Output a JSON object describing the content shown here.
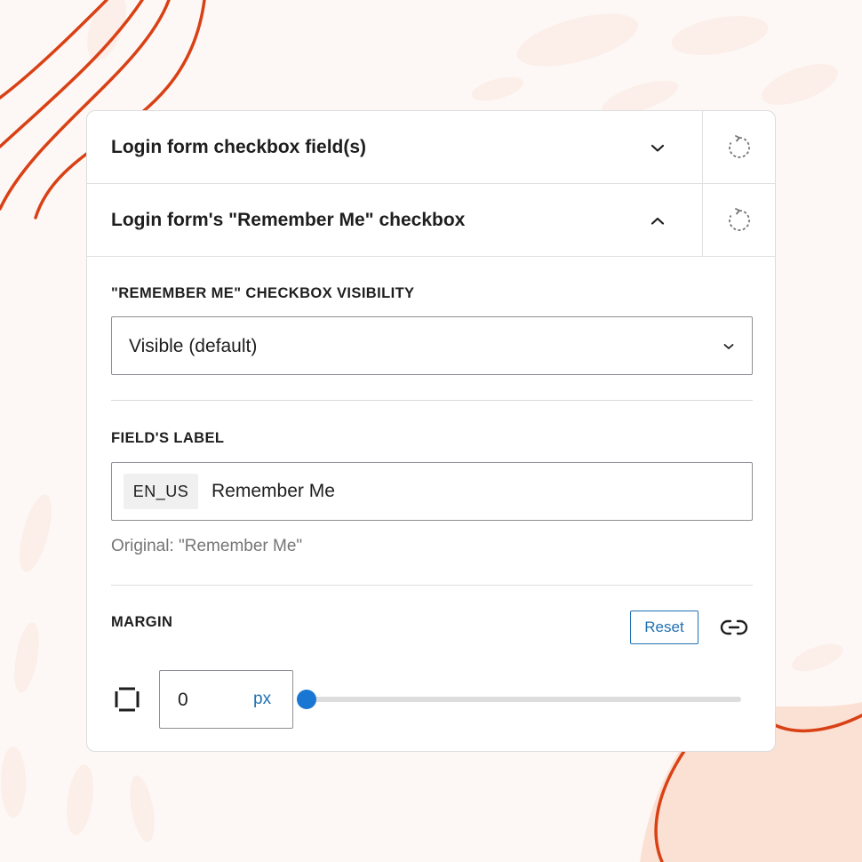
{
  "theme": {
    "accent": "#2271b1",
    "decoration": "#d94115"
  },
  "accordion": [
    {
      "title": "Login form checkbox field(s)",
      "expanded": false,
      "chevron_icon": "chevron-down-icon",
      "reset_icon": "reset-icon"
    },
    {
      "title": "Login form's \"Remember Me\" checkbox",
      "expanded": true,
      "chevron_icon": "chevron-up-icon",
      "reset_icon": "reset-icon"
    }
  ],
  "visibility": {
    "label": "\"REMEMBER ME\" CHECKBOX VISIBILITY",
    "selected": "Visible (default)"
  },
  "field_label": {
    "label": "FIELD'S LABEL",
    "locale": "EN_US",
    "value": "Remember Me",
    "original": "Original: \"Remember Me\""
  },
  "margin": {
    "label": "MARGIN",
    "reset_label": "Reset",
    "value": "0",
    "unit": "px",
    "slider_fraction": 0
  }
}
